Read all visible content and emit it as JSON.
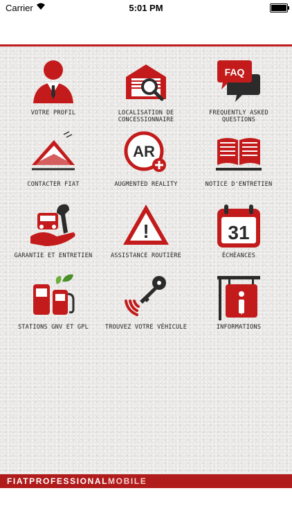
{
  "status": {
    "carrier": "Carrier",
    "time": "5:01 PM"
  },
  "tiles": [
    {
      "label": "VOTRE PROFIL",
      "icon": "profile-icon"
    },
    {
      "label": "LOCALISATION DE CONCESSIONNAIRE",
      "icon": "dealer-locator-icon"
    },
    {
      "label": "FREQUENTLY ASKED QUESTIONS",
      "icon": "faq-icon",
      "icon_text": "FAQ"
    },
    {
      "label": "CONTACTER FIAT",
      "icon": "envelope-icon"
    },
    {
      "label": "AUGMENTED REALITY",
      "icon": "ar-icon",
      "icon_text": "AR"
    },
    {
      "label": "NOTICE D'ENTRETIEN",
      "icon": "manual-book-icon"
    },
    {
      "label": "GARANTIE ET ENTRETIEN",
      "icon": "warranty-icon"
    },
    {
      "label": "ASSISTANCE ROUTIÈRE",
      "icon": "warning-triangle-icon",
      "icon_text": "!"
    },
    {
      "label": "ÉCHÉANCES",
      "icon": "calendar-icon",
      "icon_text": "31"
    },
    {
      "label": "STATIONS GNV ET GPL",
      "icon": "fuel-pump-icon"
    },
    {
      "label": "TROUVEZ VOTRE VÉHICULE",
      "icon": "car-key-icon"
    },
    {
      "label": "INFORMATIONS",
      "icon": "info-sign-icon",
      "icon_text": "i"
    }
  ],
  "footer": {
    "brand_main": "FIATPROFESSIONAL",
    "brand_suffix": "MOBILE"
  },
  "colors": {
    "accent": "#c31b1b",
    "dark": "#2b2b2b",
    "footer": "#b01b1b"
  }
}
